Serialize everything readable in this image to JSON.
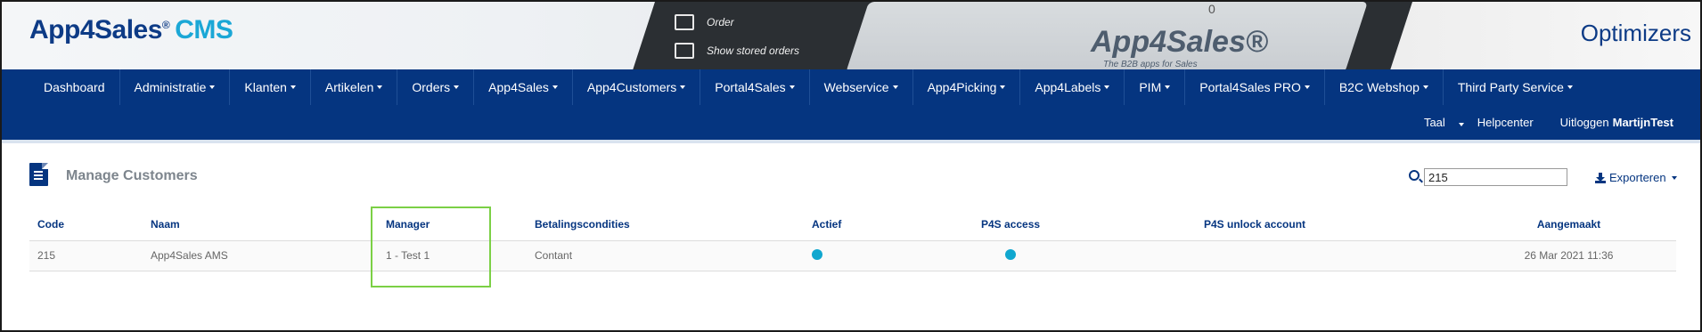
{
  "header": {
    "brand_main": "App4Sales",
    "brand_reg": "®",
    "brand_suffix": "CMS",
    "banner_menu": [
      "Order",
      "Show stored orders"
    ],
    "banner_logo": "App4Sales®",
    "banner_tagline": "The B2B apps for Sales",
    "banner_cart_count": "0",
    "partner_logo": "Optimizers"
  },
  "nav": {
    "items": [
      {
        "label": "Dashboard",
        "dropdown": false
      },
      {
        "label": "Administratie",
        "dropdown": true
      },
      {
        "label": "Klanten",
        "dropdown": true
      },
      {
        "label": "Artikelen",
        "dropdown": true
      },
      {
        "label": "Orders",
        "dropdown": true
      },
      {
        "label": "App4Sales",
        "dropdown": true
      },
      {
        "label": "App4Customers",
        "dropdown": true
      },
      {
        "label": "Portal4Sales",
        "dropdown": true
      },
      {
        "label": "Webservice",
        "dropdown": true
      },
      {
        "label": "App4Picking",
        "dropdown": true
      },
      {
        "label": "App4Labels",
        "dropdown": true
      },
      {
        "label": "PIM",
        "dropdown": true
      },
      {
        "label": "Portal4Sales PRO",
        "dropdown": true
      },
      {
        "label": "B2C Webshop",
        "dropdown": true
      },
      {
        "label": "Third Party Service",
        "dropdown": true
      }
    ],
    "util": {
      "language": "Taal",
      "help": "Helpcenter",
      "logout": "Uitloggen",
      "username": "MartijnTest"
    }
  },
  "page": {
    "title": "Manage Customers",
    "search_value": "215",
    "export_label": "Exporteren"
  },
  "table": {
    "headers": [
      "Code",
      "Naam",
      "Manager",
      "Betalingscondities",
      "Actief",
      "P4S access",
      "P4S unlock account",
      "Aangemaakt"
    ],
    "rows": [
      {
        "code": "215",
        "naam": "App4Sales AMS",
        "manager": "1 - Test 1",
        "betalingscondities": "Contant",
        "actief": true,
        "p4s_access": true,
        "p4s_unlock": "",
        "aangemaakt": "26 Mar 2021 11:36"
      }
    ]
  },
  "colors": {
    "nav_bg": "#053580",
    "brand_blue": "#0d3b86",
    "accent_cyan": "#1ba7d6",
    "dot": "#10a7cf",
    "highlight": "#7bd045"
  }
}
